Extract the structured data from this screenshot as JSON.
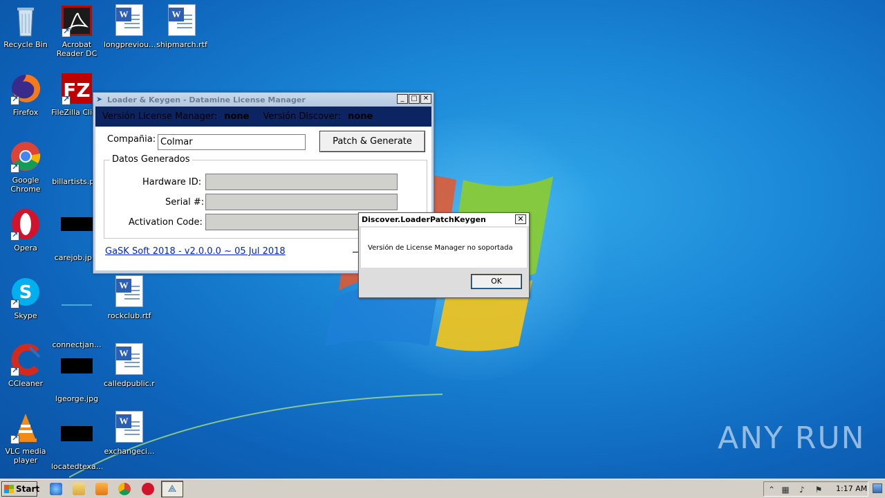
{
  "desktop_icons": [
    {
      "label": "Recycle Bin",
      "icon": "recycle-bin-icon"
    },
    {
      "label": "Acrobat Reader DC",
      "icon": "acrobat-icon"
    },
    {
      "label": "longpreviou...",
      "icon": "word-document-icon"
    },
    {
      "label": "shipmarch.rtf",
      "icon": "word-document-icon"
    },
    {
      "label": "Firefox",
      "icon": "firefox-icon"
    },
    {
      "label": "FileZilla Clie...",
      "icon": "filezilla-icon"
    },
    {
      "label": "Google Chrome",
      "icon": "chrome-icon"
    },
    {
      "label": "billartists.p...",
      "icon": "file-icon"
    },
    {
      "label": "Opera",
      "icon": "opera-icon"
    },
    {
      "label": "carejob.jp...",
      "icon": "image-file-icon"
    },
    {
      "label": "Skype",
      "icon": "skype-icon"
    },
    {
      "label": "connectjan...",
      "icon": "file-icon"
    },
    {
      "label": "rockclub.rtf",
      "icon": "word-document-icon"
    },
    {
      "label": "CCleaner",
      "icon": "ccleaner-icon"
    },
    {
      "label": "lgeorge.jpg",
      "icon": "image-file-icon"
    },
    {
      "label": "calledpublic.rtf",
      "icon": "word-document-icon"
    },
    {
      "label": "VLC media player",
      "icon": "vlc-icon"
    },
    {
      "label": "locatedtexa...",
      "icon": "image-file-icon"
    },
    {
      "label": "exchangeci...",
      "icon": "word-document-icon"
    }
  ],
  "main_window": {
    "title": "Loader & Keygen - Datamine License Manager",
    "info_label_lm": "Versión License Manager:",
    "info_value_lm": "none",
    "info_label_discover": "Versión Discover:",
    "info_value_discover": "none",
    "company_label": "Compañia:",
    "company_value": "Colmar",
    "patch_button": "Patch & Generate",
    "group_title": "Datos Generados",
    "hardware_label": "Hardware ID:",
    "serial_label": "Serial #:",
    "activation_label": "Activation Code:",
    "footer_link": "GaSK Soft 2018 - v2.0.0.0 ~ 05 Jul 2018"
  },
  "dialog": {
    "title": "Discover.LoaderPatchKeygen",
    "message": "Versión de License Manager no soportada",
    "ok_label": "OK"
  },
  "taskbar": {
    "start_label": "Start",
    "clock": "1:17 AM",
    "pinned": [
      "internet-explorer-icon",
      "folder-icon",
      "media-player-icon",
      "chrome-icon",
      "opera-icon",
      "keygen-app-icon"
    ]
  },
  "watermark": "ANY RUN"
}
